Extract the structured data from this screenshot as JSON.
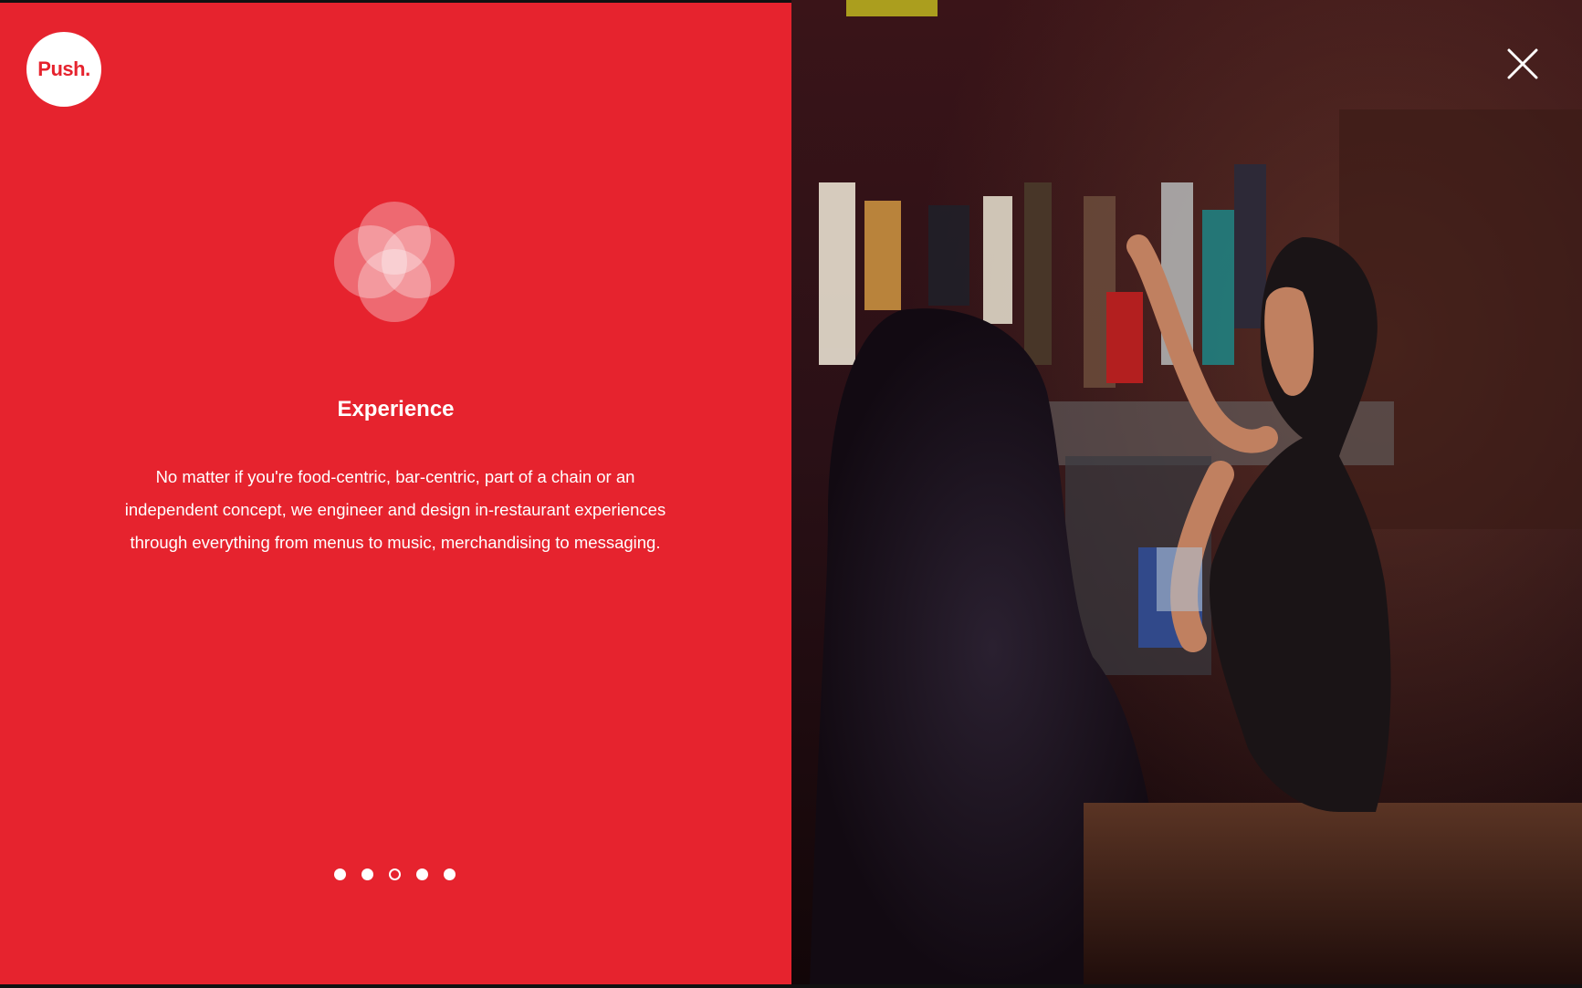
{
  "brand": {
    "logo_text": "Push.",
    "accent_color": "#e6232e"
  },
  "slide": {
    "icon": "overlapping-circles-icon",
    "title": "Experience",
    "description": "No matter if you're food-centric, bar-centric, part of a chain or an independent concept, we engineer and design in-restaurant experiences through everything from menus to music, merchandising to messaging."
  },
  "pagination": {
    "total": 5,
    "current": 3
  },
  "controls": {
    "close_icon": "close-icon"
  }
}
